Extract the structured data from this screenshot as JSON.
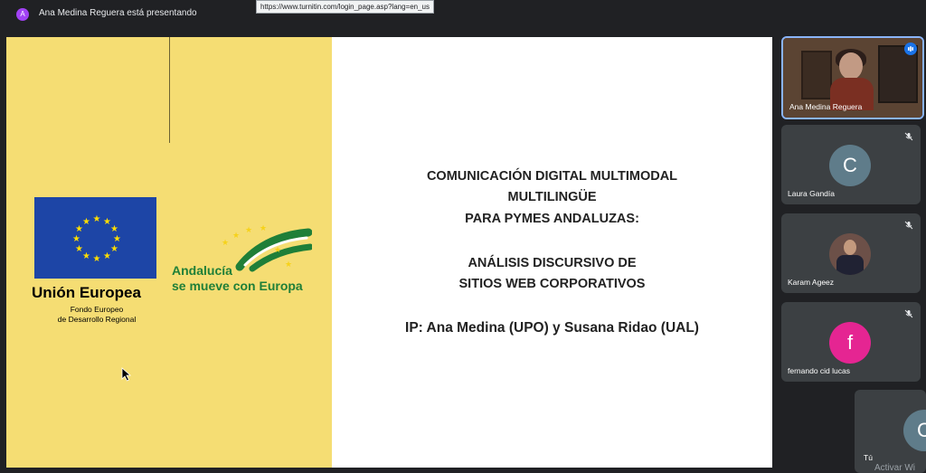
{
  "topbar": {
    "presenter_initial": "A",
    "presenter_text": "Ana Medina Reguera está presentando",
    "url_tooltip": "https://www.turnitin.com/login_page.asp?lang=en_us"
  },
  "slide": {
    "eu_title": "Unión Europea",
    "eu_sub1": "Fondo Europeo",
    "eu_sub2": "de Desarrollo Regional",
    "andalucia_line1": "Andalucía",
    "andalucia_line2": "se mueve con Europa",
    "title_lines": [
      "COMUNICACIÓN DIGITAL MULTIMODAL",
      "MULTILINGÜE",
      "PARA PYMES ANDALUZAS:",
      "ANÁLISIS DISCURSIVO DE",
      "SITIOS WEB CORPORATIVOS",
      "IP: Ana Medina (UPO) y Susana Ridao (UAL)"
    ]
  },
  "participants": [
    {
      "name": "Ana Medina Reguera",
      "type": "video",
      "speaking": true
    },
    {
      "name": "Laura Gandía",
      "initial": "C",
      "avatar_color": "#5f7c8a",
      "muted": true
    },
    {
      "name": "Karam Ageez",
      "type": "photo",
      "muted": true
    },
    {
      "name": "fernando cid lucas",
      "initial": "f",
      "avatar_color": "#e52592",
      "muted": true
    }
  ],
  "self": {
    "name": "Tú",
    "initial": "C"
  },
  "watermark": "Activar Wi"
}
